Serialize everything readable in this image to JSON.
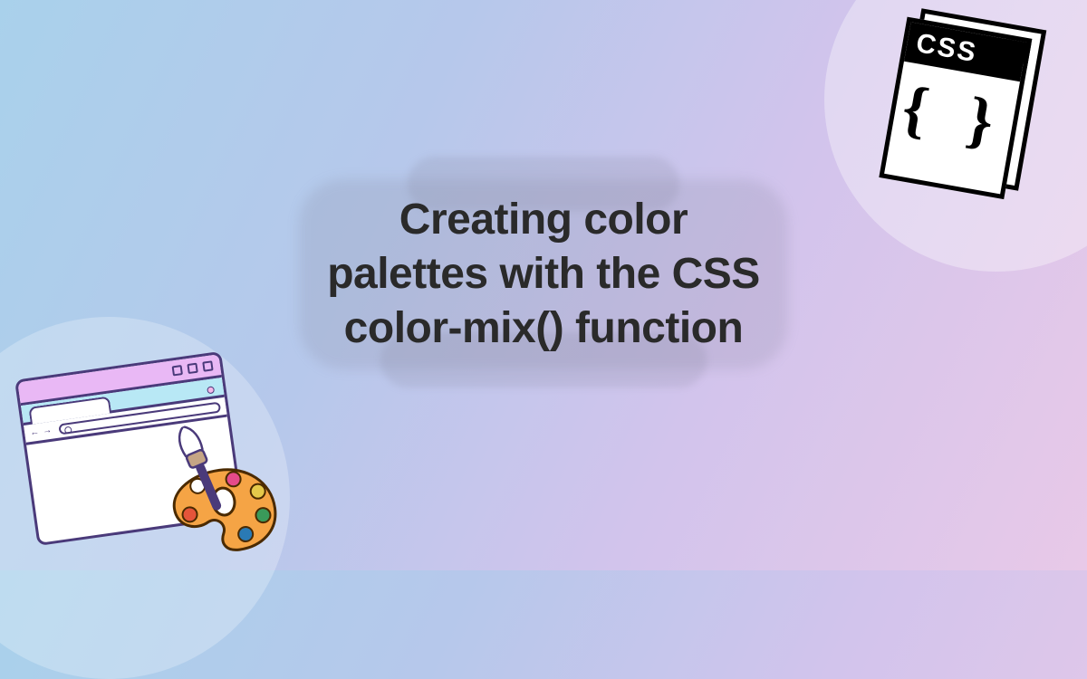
{
  "title": "Creating color palettes with the CSS color-mix() function",
  "icons": {
    "css_file": {
      "label": "CSS",
      "braces": "{ }"
    },
    "palette_colors": [
      "#ffffff",
      "#e54a8a",
      "#e5c94a",
      "#3a9a5a",
      "#2a7ab5",
      "#e5543a"
    ]
  }
}
